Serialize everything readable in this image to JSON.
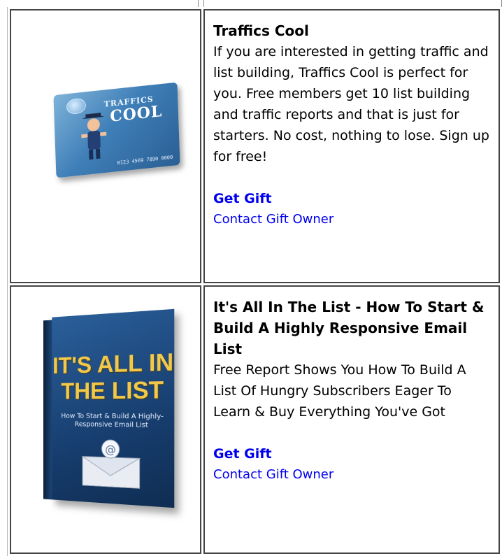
{
  "gifts": [
    {
      "title": "Traffics Cool",
      "description": "If you are interested in getting traffic and list building, Traffics Cool is perfect for you. Free members get 10 list building and traffic reports and that is just for starters. No cost, nothing to lose. Sign up for free!",
      "get_gift_label": "Get Gift",
      "contact_label": "Contact Gift Owner",
      "image": {
        "brand_line1": "TRAFFICS",
        "brand_line2": "COOL",
        "card_number": "0123 4569 7890 0000"
      }
    },
    {
      "title": "It's All In The List - How To Start & Build A Highly Responsive Email List",
      "description": "Free Report Shows You How To Build A List Of Hungry Subscribers Eager To Learn & Buy Everything You've Got",
      "get_gift_label": "Get Gift",
      "contact_label": "Contact Gift Owner",
      "image": {
        "book_title": "IT'S ALL IN THE LIST",
        "book_subtitle": "How To Start & Build A Highly-Responsive Email List"
      }
    }
  ],
  "colors": {
    "link": "#0000ee",
    "border": "#444444"
  }
}
